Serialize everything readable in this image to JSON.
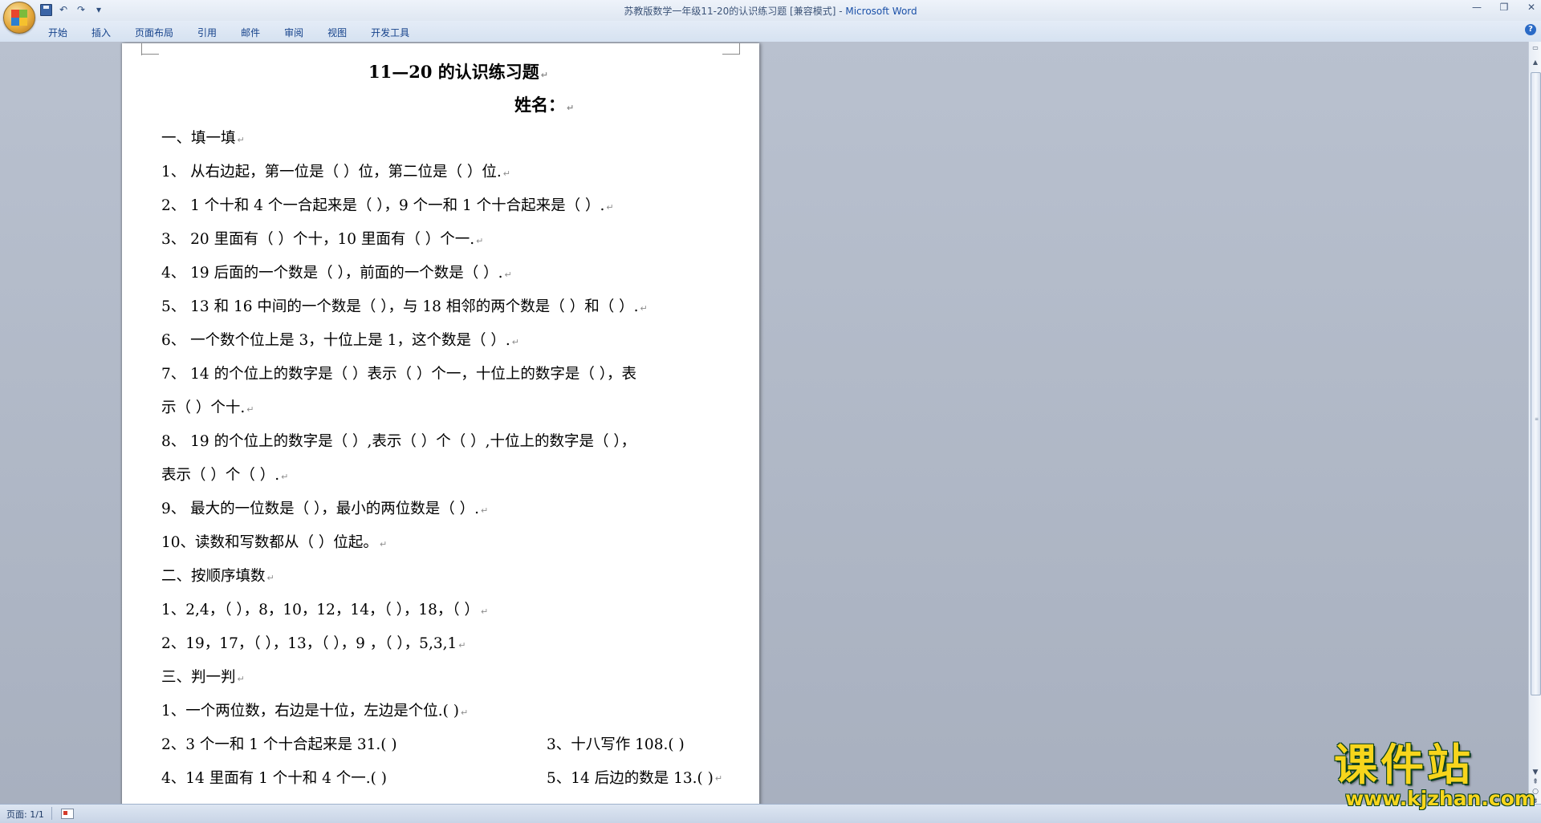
{
  "window": {
    "title_doc": "苏教版数学一年级11-20的认识练习题 [兼容模式] - ",
    "title_app": "Microsoft Word"
  },
  "ribbon": {
    "tabs": [
      "开始",
      "插入",
      "页面布局",
      "引用",
      "邮件",
      "审阅",
      "视图",
      "开发工具"
    ]
  },
  "document": {
    "title": "11—20 的认识练习题",
    "name_label": "姓名：",
    "lines": [
      "一、填一填",
      "1、  从右边起，第一位是（  ）位，第二位是（  ）位.",
      "2、  1 个十和 4 个一合起来是（  ），9 个一和 1 个十合起来是（  ）.",
      "3、  20 里面有（  ）个十，10 里面有（  ）个一.",
      "4、  19 后面的一个数是（  ），前面的一个数是（  ）.",
      "5、  13 和 16 中间的一个数是（  ），与 18 相邻的两个数是（  ）和（  ）.",
      "6、  一个数个位上是 3，十位上是 1，这个数是（  ）.",
      "7、  14  的个位上的数字是（  ）表示（  ）个一，十位上的数字是（  ），表",
      "示（  ）个十.",
      "8、  19  的个位上的数字是（  ）,表示（  ）个（  ）,十位上的数字是（    ），",
      "表示（  ）个（  ）.",
      "9、  最大的一位数是（  ），最小的两位数是（  ）.",
      "10、读数和写数都从（  ）位起。",
      "二、按顺序填数",
      "1、2,4，（    ），8，10，12，14，（  ），18，（  ）",
      "2、19，17，（  ），13，（  ），9 ，（    ），5,3,1",
      "三、判一判",
      "1、一个两位数，右边是十位，左边是个位.(    )"
    ],
    "pair_lines": [
      {
        "left": "2、3  个一和  1  个十合起来是  31.(    )",
        "right": "3、十八写作  108.(    )"
      },
      {
        "left": "4、14 里面有 1 个十和 4 个一.(    )",
        "right": "5、14 后边的数是 13.(    )"
      }
    ]
  },
  "statusbar": {
    "page_info": "页面: 1/1"
  },
  "watermark": {
    "text": "课件站",
    "url": "www.kjzhan.com"
  }
}
